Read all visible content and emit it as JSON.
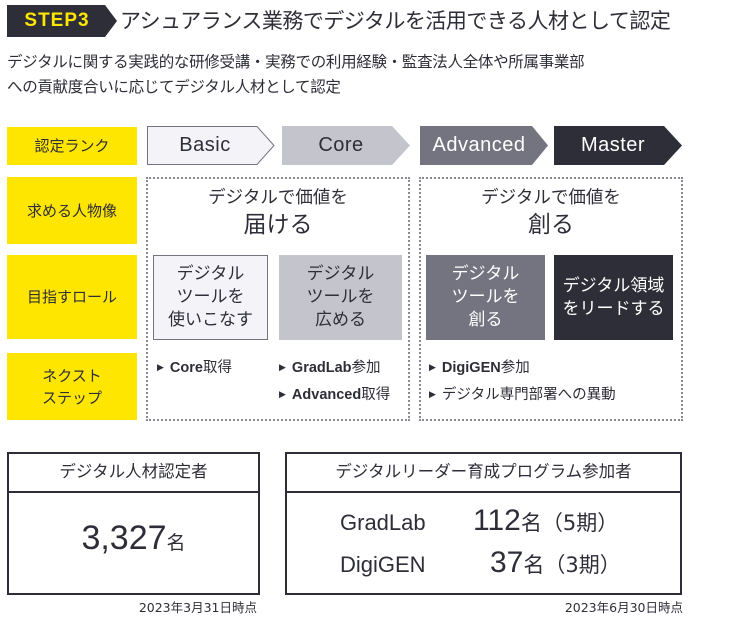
{
  "header": {
    "step_badge": "STEP3",
    "title": "アシュアランス業務でデジタルを活用できる人材として認定",
    "subtitle_lines": [
      "デジタルに関する実践的な研修受講・実務での利用経験・監査法人全体や所属事業部",
      "への貢献度合いに応じてデジタル人材として認定"
    ]
  },
  "row_labels": {
    "rank": "認定ランク",
    "persona": "求める人物像",
    "role": "目指すロール",
    "next_step_lines": [
      "ネクスト",
      "ステップ"
    ]
  },
  "ranks": [
    {
      "name": "Basic",
      "fill": "#f4f4f8",
      "text_color": "#2e2e38",
      "stroke": "#747480"
    },
    {
      "name": "Core",
      "fill": "#c4c4cd",
      "text_color": "#2e2e38",
      "stroke": "none"
    },
    {
      "name": "Advanced",
      "fill": "#747480",
      "text_color": "#ffffff",
      "stroke": "none"
    },
    {
      "name": "Master",
      "fill": "#2e2e38",
      "text_color": "#ffffff",
      "stroke": "none"
    }
  ],
  "personas": [
    {
      "line1": "デジタルで価値を",
      "line2": "届ける"
    },
    {
      "line1": "デジタルで価値を",
      "line2": "創る"
    }
  ],
  "roles": [
    {
      "lines": [
        "デジタル",
        "ツールを",
        "使いこなす"
      ],
      "fill": "#f4f4f8",
      "text_color": "#2e2e38"
    },
    {
      "lines": [
        "デジタル",
        "ツールを",
        "広める"
      ],
      "fill": "#c4c4cd",
      "text_color": "#2e2e38"
    },
    {
      "lines": [
        "デジタル",
        "ツールを",
        "創る"
      ],
      "fill": "#747480",
      "text_color": "#ffffff"
    },
    {
      "lines": [
        "デジタル領域",
        "をリードする"
      ],
      "fill": "#2e2e38",
      "text_color": "#ffffff"
    }
  ],
  "next_steps": {
    "basic": [
      {
        "en": "Core",
        "jp": "取得"
      }
    ],
    "core": [
      {
        "en": "GradLab",
        "jp": "参加"
      },
      {
        "en": "Advanced",
        "jp": "取得"
      }
    ],
    "advanced_master": [
      {
        "en": "DigiGEN",
        "jp": "参加"
      },
      {
        "en": "",
        "jp": "デジタル専門部署への異動"
      }
    ]
  },
  "stats": {
    "certified": {
      "title": "デジタル人材認定者",
      "count": "3,327",
      "unit": "名",
      "as_of": "2023年3月31日時点"
    },
    "programs": {
      "title": "デジタルリーダー育成プログラム参加者",
      "rows": [
        {
          "program": "GradLab",
          "count": "112",
          "unit": "名",
          "cohorts": "（5期）"
        },
        {
          "program": "DigiGEN",
          "count": "37",
          "unit": "名",
          "cohorts": "（3期）"
        }
      ],
      "as_of": "2023年6月30日時点"
    }
  },
  "colors": {
    "accent_yellow": "#ffe600",
    "dark": "#2e2e38",
    "mid_gray": "#747480",
    "light_gray": "#c4c4cd",
    "pale": "#f4f4f8"
  }
}
